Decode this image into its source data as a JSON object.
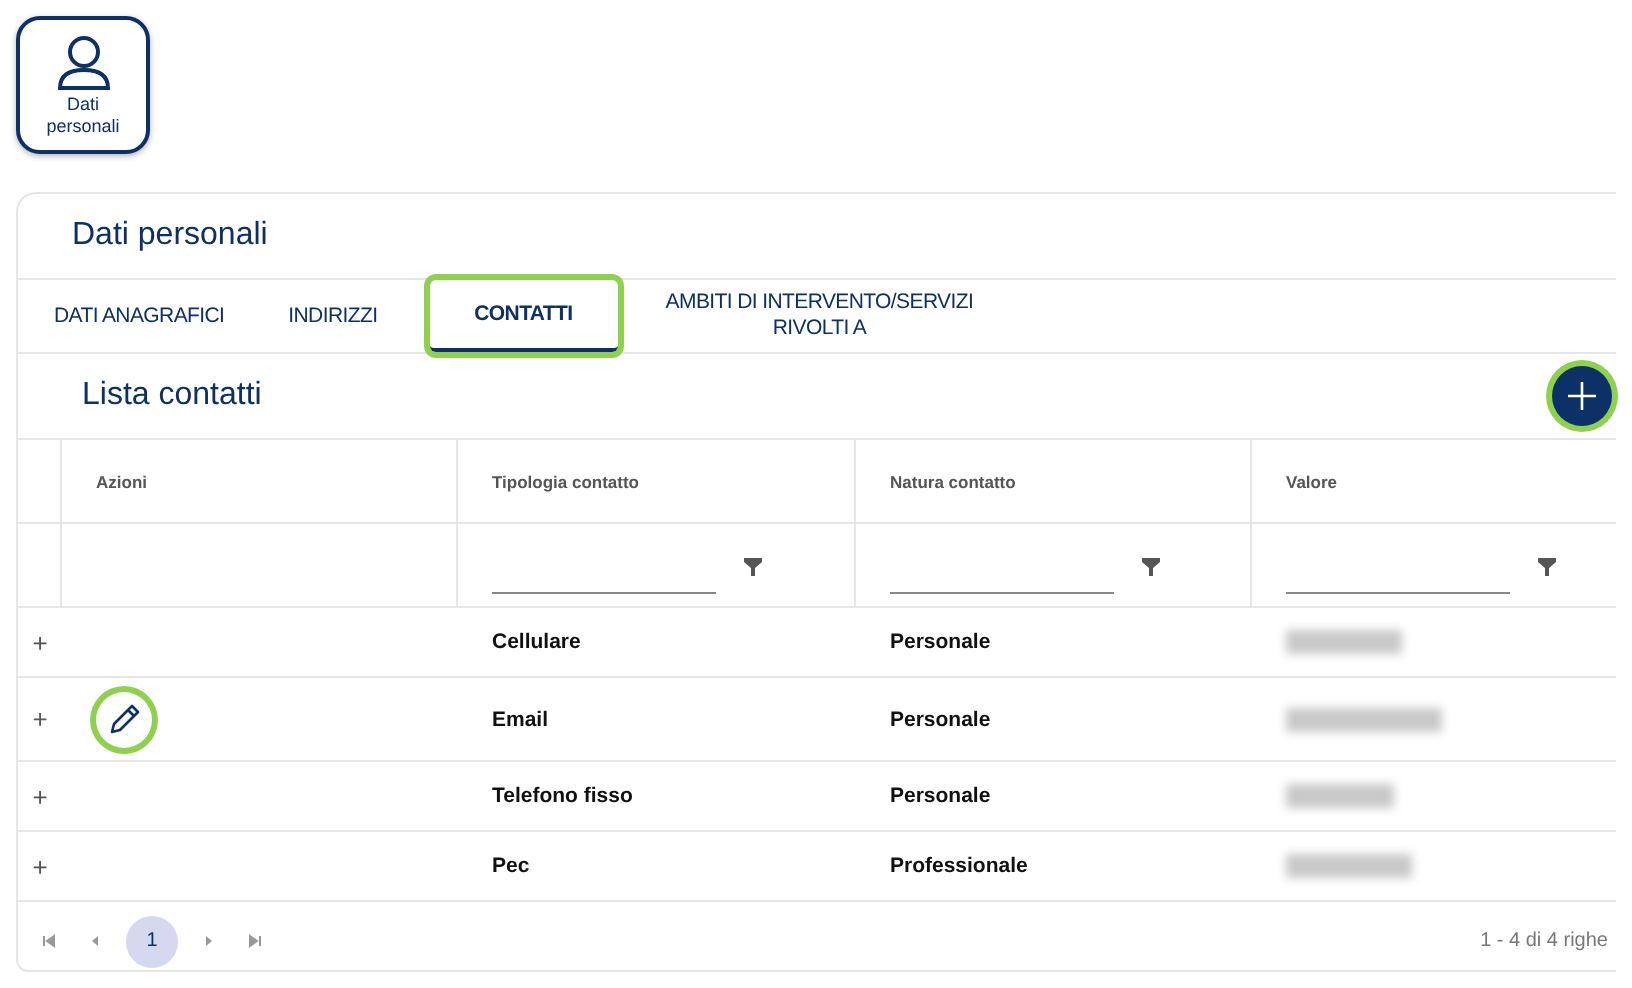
{
  "profile_card": {
    "label": "Dati personali"
  },
  "panel": {
    "title": "Dati personali"
  },
  "tabs": [
    {
      "label": "DATI ANAGRAFICI",
      "selected": false,
      "highlighted": false
    },
    {
      "label": "INDIRIZZI",
      "selected": false,
      "highlighted": false
    },
    {
      "label": "CONTATTI",
      "selected": true,
      "highlighted": true
    },
    {
      "label": "AMBITI DI INTERVENTO/SERVIZI RIVOLTI A",
      "selected": false,
      "highlighted": false
    }
  ],
  "list": {
    "title": "Lista contatti",
    "add_button": {
      "highlighted": true
    }
  },
  "table": {
    "columns": [
      {
        "label": "Azioni",
        "filter": false
      },
      {
        "label": "Tipologia contatto",
        "filter": true
      },
      {
        "label": "Natura contatto",
        "filter": true
      },
      {
        "label": "Valore",
        "filter": true
      }
    ],
    "rows": [
      {
        "expand": "+",
        "edit": false,
        "tipologia": "Cellulare",
        "natura": "Personale"
      },
      {
        "expand": "+",
        "edit": true,
        "tipologia": "Email",
        "natura": "Personale"
      },
      {
        "expand": "+",
        "edit": false,
        "tipologia": "Telefono fisso",
        "natura": "Personale"
      },
      {
        "expand": "+",
        "edit": false,
        "tipologia": "Pec",
        "natura": "Professionale"
      }
    ]
  },
  "pagination": {
    "pages": [
      {
        "label": "1",
        "selected": true
      }
    ],
    "summary": "1 - 4 di 4 righe"
  }
}
